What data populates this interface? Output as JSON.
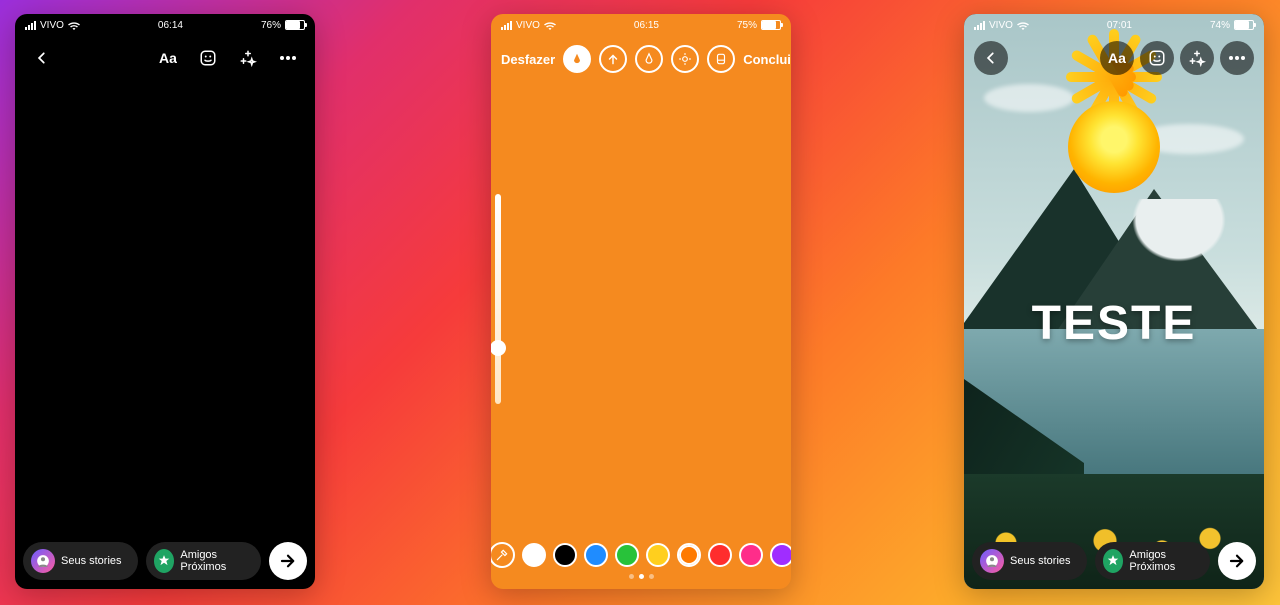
{
  "phones": {
    "p1": {
      "status": {
        "carrier": "VIVO",
        "time": "06:14",
        "battery_pct": "76%"
      },
      "toolbar": {
        "text_label": "Aa"
      },
      "share": {
        "stories_label": "Seus stories",
        "close_label": "Amigos Próximos"
      }
    },
    "p2": {
      "status": {
        "carrier": "VIVO",
        "time": "06:15",
        "battery_pct": "75%"
      },
      "draw": {
        "undo_label": "Desfazer",
        "done_label": "Concluir"
      },
      "palette": {
        "colors": [
          "#ffffff",
          "#000000",
          "#1f8cff",
          "#28c23a",
          "#ffcf1e",
          "#ff7a00",
          "#ff2d2d",
          "#ff2d8a",
          "#a02dff"
        ],
        "selected_index": 5,
        "page_count": 3,
        "active_page": 1
      }
    },
    "p3": {
      "status": {
        "carrier": "VIVO",
        "time": "07:01",
        "battery_pct": "74%"
      },
      "toolbar": {
        "text_label": "Aa"
      },
      "overlay_text": "TESTE",
      "share": {
        "stories_label": "Seus stories",
        "close_label": "Amigos Próximos"
      }
    }
  }
}
